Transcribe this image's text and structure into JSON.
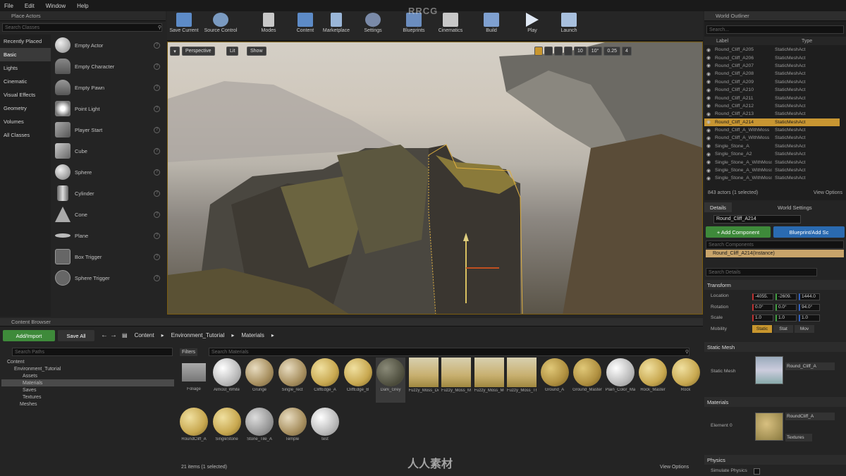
{
  "menu": [
    "File",
    "Edit",
    "Window",
    "Help"
  ],
  "place_actors": {
    "title": "Place Actors",
    "search_placeholder": "Search Classes",
    "categories": [
      "Recently Placed",
      "Basic",
      "Lights",
      "Cinematic",
      "Visual Effects",
      "Geometry",
      "Volumes",
      "All Classes"
    ],
    "items": [
      "Empty Actor",
      "Empty Character",
      "Empty Pawn",
      "Point Light",
      "Player Start",
      "Cube",
      "Sphere",
      "Cylinder",
      "Cone",
      "Plane",
      "Box Trigger",
      "Sphere Trigger"
    ]
  },
  "toolbar": {
    "buttons": [
      "Save Current",
      "Source Control",
      "Modes",
      "Content",
      "Marketplace",
      "Settings",
      "Blueprints",
      "Cinematics",
      "Build",
      "Play",
      "Launch"
    ],
    "watermark": "RRCG"
  },
  "viewport": {
    "perspective": "Perspective",
    "lit": "Lit",
    "show": "Show",
    "grid_snap": "10",
    "rot_snap": "10°",
    "scale_snap": "0.25",
    "cam_speed": "4"
  },
  "outliner": {
    "title": "World Outliner",
    "search_placeholder": "Search...",
    "col_label": "Label",
    "col_type": "Type",
    "rows": [
      {
        "name": "Round_Cliff_A205",
        "type": "StaticMeshAct"
      },
      {
        "name": "Round_Cliff_A206",
        "type": "StaticMeshAct"
      },
      {
        "name": "Round_Cliff_A207",
        "type": "StaticMeshAct"
      },
      {
        "name": "Round_Cliff_A208",
        "type": "StaticMeshAct"
      },
      {
        "name": "Round_Cliff_A209",
        "type": "StaticMeshAct"
      },
      {
        "name": "Round_Cliff_A210",
        "type": "StaticMeshAct"
      },
      {
        "name": "Round_Cliff_A211",
        "type": "StaticMeshAct"
      },
      {
        "name": "Round_Cliff_A212",
        "type": "StaticMeshAct"
      },
      {
        "name": "Round_Cliff_A213",
        "type": "StaticMeshAct"
      },
      {
        "name": "Round_Cliff_A214",
        "type": "StaticMeshAct"
      },
      {
        "name": "Round_Cliff_A_WithMoss",
        "type": "StaticMeshAct"
      },
      {
        "name": "Round_Cliff_A_WithMoss",
        "type": "StaticMeshAct"
      },
      {
        "name": "Single_Stone_A",
        "type": "StaticMeshAct"
      },
      {
        "name": "Single_Stone_A2",
        "type": "StaticMeshAct"
      },
      {
        "name": "Single_Stone_A_WithMoss",
        "type": "StaticMeshAct"
      },
      {
        "name": "Single_Stone_A_WithMoss",
        "type": "StaticMeshAct"
      },
      {
        "name": "Single_Stone_A_WithMoss",
        "type": "StaticMeshAct"
      }
    ],
    "status": "843 actors (1 selected)",
    "view_options": "View Options"
  },
  "details": {
    "tab_details": "Details",
    "tab_world": "World Settings",
    "name_value": "Round_Cliff_A214",
    "add_component": "+ Add Component",
    "blueprint": "Blueprint/Add Sc",
    "search_components": "Search Components",
    "instance": "Round_Cliff_A214(Instance)",
    "search_details": "Search Details",
    "transform": "Transform",
    "location": "Location",
    "rotation": "Rotation",
    "scale": "Scale",
    "mobility": "Mobility",
    "loc": [
      "-4055.",
      "-2609.",
      "1444.0"
    ],
    "rot": [
      "0.0°",
      "0.0°",
      "94.0°"
    ],
    "scl": [
      "1.0",
      "1.0",
      "1.0"
    ],
    "mob": [
      "Static",
      "Stat",
      "Mov"
    ],
    "static_mesh_section": "Static Mesh",
    "static_mesh_label": "Static Mesh",
    "static_mesh_value": "Round_Cliff_A",
    "materials_section": "Materials",
    "element0": "Element 0",
    "material_value": "RoundCliff_A",
    "textures": "Textures",
    "physics": "Physics",
    "simulate": "Simulate Physics"
  },
  "content_browser": {
    "title": "Content Browser",
    "add_import": "Add/Import",
    "save_all": "Save All",
    "path": [
      "Content",
      "Environment_Tutorial",
      "Materials"
    ],
    "search_paths": "Search Paths",
    "filters": "Filters",
    "search_materials": "Search Materials",
    "tree": [
      "Content",
      "Environment_Tutorial",
      "Assets",
      "Materials",
      "Saves",
      "Textures",
      "Meshes"
    ],
    "assets": [
      {
        "label": "Foliage",
        "kind": "folder"
      },
      {
        "label": "Almost_White",
        "kind": "white"
      },
      {
        "label": "Grunge",
        "kind": "rock"
      },
      {
        "label": "Single_rect",
        "kind": "rock"
      },
      {
        "label": "CliffEdge_A",
        "kind": "moss"
      },
      {
        "label": "CliffEdge_B",
        "kind": "moss"
      },
      {
        "label": "Dark_Grey",
        "kind": "dark"
      },
      {
        "label": "Fuzzy_Moss_Dense",
        "kind": "mossq"
      },
      {
        "label": "Fuzzy_Moss_Master",
        "kind": "mossq"
      },
      {
        "label": "Fuzzy_Moss_Medium",
        "kind": "mossq"
      },
      {
        "label": "Fuzzy_Moss_Thin",
        "kind": "mossq"
      },
      {
        "label": "Ground_A",
        "kind": "ground"
      },
      {
        "label": "Ground_Master",
        "kind": "ground"
      },
      {
        "label": "Plain_Color_Master",
        "kind": "white"
      },
      {
        "label": "Rock_Master",
        "kind": "moss"
      },
      {
        "label": "Rock",
        "kind": "moss"
      },
      {
        "label": "RoundCliff_A",
        "kind": "moss"
      },
      {
        "label": "SingleStone",
        "kind": "moss"
      },
      {
        "label": "Stone_Tile_A",
        "kind": "grey"
      },
      {
        "label": "Temple",
        "kind": "rock"
      },
      {
        "label": "test",
        "kind": "white"
      }
    ],
    "status": "21 items (1 selected)",
    "view_options": "View Options"
  },
  "watermark_text": "人人素材"
}
